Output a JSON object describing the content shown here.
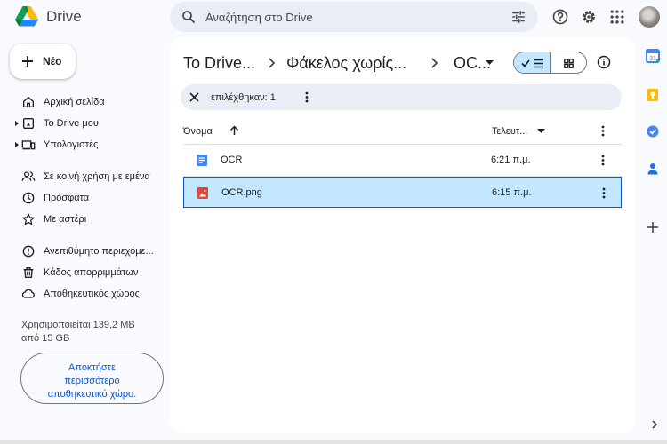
{
  "app": {
    "brand": "Drive"
  },
  "search": {
    "placeholder": "Αναζήτηση στο Drive"
  },
  "new_button": {
    "label": "Νέο"
  },
  "sidebar": {
    "items": [
      {
        "label": "Αρχική σελίδα",
        "icon": "home-icon"
      },
      {
        "label": "Το Drive μου",
        "icon": "my-drive-icon"
      },
      {
        "label": "Υπολογιστές",
        "icon": "computers-icon"
      },
      {
        "label": "Σε κοινή χρήση με εμένα",
        "icon": "shared-icon"
      },
      {
        "label": "Πρόσφατα",
        "icon": "clock-icon"
      },
      {
        "label": "Με αστέρι",
        "icon": "star-icon"
      },
      {
        "label": "Ανεπιθύμητο περιεχόμε...",
        "icon": "spam-icon"
      },
      {
        "label": "Κάδος απορριμμάτων",
        "icon": "trash-icon"
      },
      {
        "label": "Αποθηκευτικός χώρος",
        "icon": "cloud-icon"
      }
    ],
    "storage_line1": "Χρησιμοποιείται 139,2 MB",
    "storage_line2": "από 15 GB",
    "get_storage_line1": "Αποκτήστε",
    "get_storage_line2": "περισσότερο",
    "get_storage_line3": "αποθηκευτικό χώρο."
  },
  "breadcrumb": {
    "items": [
      "Το Drive...",
      "Φάκελος χωρίς...",
      "OC..."
    ]
  },
  "selection": {
    "text": "επιλέχθηκαν: 1"
  },
  "table": {
    "columns": {
      "name": "Όνομα",
      "modified": "Τελευτ..."
    },
    "rows": [
      {
        "name": "OCR",
        "time": "6:21 π.μ.",
        "type": "doc",
        "selected": false
      },
      {
        "name": "OCR.png",
        "time": "6:15 π.μ.",
        "type": "image",
        "selected": true
      }
    ]
  },
  "colors": {
    "accent": "#0b57d0",
    "selected_bg": "#c2e7ff",
    "doc_blue": "#4285f4",
    "image_red": "#ea4335"
  }
}
